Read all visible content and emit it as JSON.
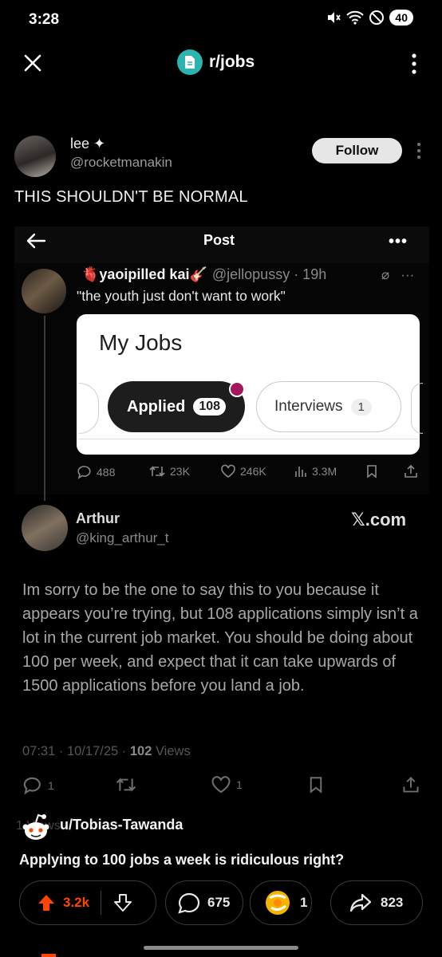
{
  "status_bar": {
    "time": "3:28",
    "battery": "40"
  },
  "top_bar": {
    "subreddit": "r/jobs"
  },
  "tweet": {
    "author_name": "lee",
    "author_handle": "@rocketmanakin",
    "follow_label": "Follow",
    "text": "THIS SHOULDN'T BE NORMAL"
  },
  "embedded_post": {
    "header_title": "Post",
    "header_more": "•••",
    "original": {
      "name": "🫀yaoipilled kai🎸",
      "handle_time": "@jellopussy · 19h",
      "text": "\"the youth just don't want to work\"",
      "card": {
        "title": "My Jobs",
        "chip_applied_label": "Applied",
        "chip_applied_count": "108",
        "chip_interviews_label": "Interviews",
        "chip_interviews_count": "1"
      },
      "actions": {
        "replies": "488",
        "reposts": "23K",
        "likes": "246K",
        "views": "3.3M"
      }
    },
    "reply": {
      "name": "Arthur",
      "handle": "@king_arthur_t",
      "watermark": "𝕏.com",
      "text": "Im sorry to be the one to say this to you because it appears you’re trying, but 108 applications simply isn’t a lot in the current job market. You should be doing about 100 per week, and expect that it can take upwards of 1500 applications before you land a job.",
      "meta_time": "07:31 · 10/17/25 · ",
      "meta_views_count": "102",
      "meta_views_label": " Views",
      "actions": {
        "replies": "1",
        "likes": "1"
      }
    },
    "ghost_views": "1                            Views"
  },
  "reddit_post": {
    "username": "u/Tobias-Tawanda",
    "title": "Applying to 100 jobs a week is ridiculous right?",
    "upvotes": "3.2k",
    "comments": "675",
    "awards": "1",
    "shares": "823"
  },
  "colors": {
    "upvote": "#ff4500",
    "subreddit_icon": "#2bb3ae",
    "notification_dot": "#a3185c"
  }
}
